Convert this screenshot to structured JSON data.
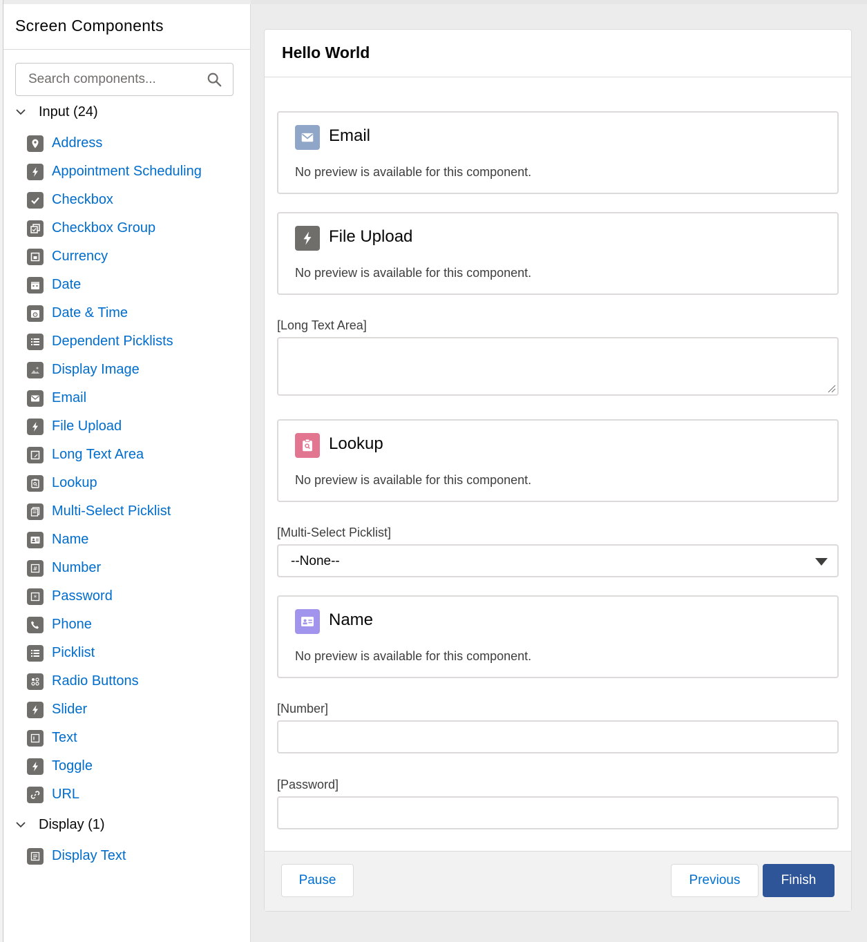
{
  "sidebar": {
    "title": "Screen Components",
    "search": {
      "placeholder": "Search components...",
      "value": ""
    },
    "sections": [
      {
        "label": "Input (24)",
        "items": [
          {
            "label": "Address",
            "icon": "location-pin-icon"
          },
          {
            "label": "Appointment Scheduling",
            "icon": "flow-bolt-icon"
          },
          {
            "label": "Checkbox",
            "icon": "checkbox-icon"
          },
          {
            "label": "Checkbox Group",
            "icon": "checkbox-group-icon"
          },
          {
            "label": "Currency",
            "icon": "currency-icon"
          },
          {
            "label": "Date",
            "icon": "calendar-icon"
          },
          {
            "label": "Date & Time",
            "icon": "datetime-icon"
          },
          {
            "label": "Dependent Picklists",
            "icon": "list-icon"
          },
          {
            "label": "Display Image",
            "icon": "image-icon"
          },
          {
            "label": "Email",
            "icon": "email-icon"
          },
          {
            "label": "File Upload",
            "icon": "flow-bolt-icon"
          },
          {
            "label": "Long Text Area",
            "icon": "textarea-icon"
          },
          {
            "label": "Lookup",
            "icon": "lookup-icon"
          },
          {
            "label": "Multi-Select Picklist",
            "icon": "multiselect-icon"
          },
          {
            "label": "Name",
            "icon": "contact-card-icon"
          },
          {
            "label": "Number",
            "icon": "number-icon"
          },
          {
            "label": "Password",
            "icon": "password-icon"
          },
          {
            "label": "Phone",
            "icon": "phone-icon"
          },
          {
            "label": "Picklist",
            "icon": "list-icon"
          },
          {
            "label": "Radio Buttons",
            "icon": "radio-icon"
          },
          {
            "label": "Slider",
            "icon": "flow-bolt-icon"
          },
          {
            "label": "Text",
            "icon": "text-icon"
          },
          {
            "label": "Toggle",
            "icon": "flow-bolt-icon"
          },
          {
            "label": "URL",
            "icon": "link-icon"
          }
        ]
      },
      {
        "label": "Display (1)",
        "items": [
          {
            "label": "Display Text",
            "icon": "display-text-icon"
          }
        ]
      }
    ]
  },
  "canvas": {
    "title": "Hello World",
    "cards": {
      "email": {
        "title": "Email",
        "description": "No preview is available for this component.",
        "icon": "email-icon",
        "color": "#8fa6c9"
      },
      "file_upload": {
        "title": "File Upload",
        "description": "No preview is available for this component.",
        "icon": "flow-bolt-icon",
        "color": "#706e6b"
      },
      "lookup": {
        "title": "Lookup",
        "description": "No preview is available for this component.",
        "icon": "lookup-icon",
        "color": "#e27590"
      },
      "name": {
        "title": "Name",
        "description": "No preview is available for this component.",
        "icon": "contact-card-icon",
        "color": "#a094ed"
      }
    },
    "long_text_area": {
      "label": "[Long Text Area]",
      "value": ""
    },
    "multi_select": {
      "label": "[Multi-Select Picklist]",
      "value": "--None--"
    },
    "number": {
      "label": "[Number]",
      "value": ""
    },
    "password": {
      "label": "[Password]",
      "value": ""
    }
  },
  "footer": {
    "pause_label": "Pause",
    "previous_label": "Previous",
    "finish_label": "Finish"
  },
  "colors": {
    "link": "#006dcc",
    "brand_button": "#2e5597",
    "icon_gray": "#706e6b"
  }
}
